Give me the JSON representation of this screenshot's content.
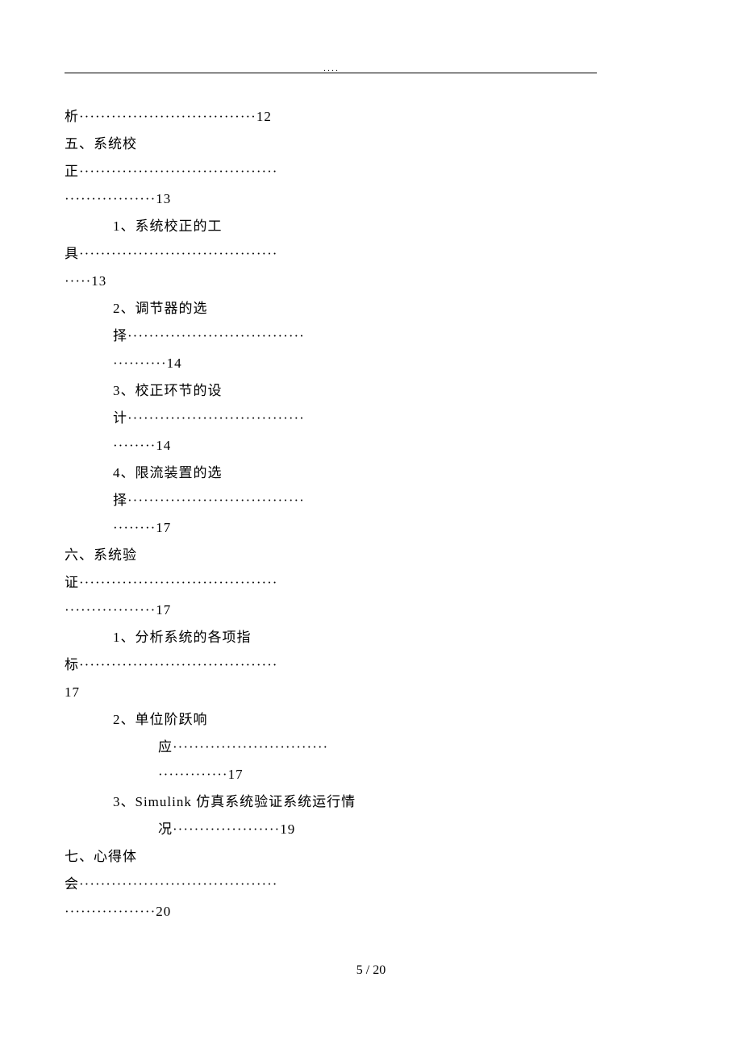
{
  "header_dots": ".                .                       .            .",
  "lines": [
    {
      "cls": "",
      "text": "析·································12"
    },
    {
      "cls": "",
      "text": "五、系统校"
    },
    {
      "cls": "",
      "text": "正·····································"
    },
    {
      "cls": "",
      "text": "·················13"
    },
    {
      "cls": "indent1",
      "text": "1、系统校正的工"
    },
    {
      "cls": "",
      "text": "具·····································"
    },
    {
      "cls": "",
      "text": "·····13"
    },
    {
      "cls": "indent1",
      "text": "2、调节器的选"
    },
    {
      "cls": "indent1",
      "text": "择·································"
    },
    {
      "cls": "indent1",
      "text": "··········14"
    },
    {
      "cls": "indent1",
      "text": "3、校正环节的设"
    },
    {
      "cls": "indent1",
      "text": "计·································"
    },
    {
      "cls": "indent1",
      "text": "········14"
    },
    {
      "cls": "indent1",
      "text": "4、限流装置的选"
    },
    {
      "cls": "indent1",
      "text": "择·································"
    },
    {
      "cls": "indent1",
      "text": "········17"
    },
    {
      "cls": "",
      "text": "六、系统验"
    },
    {
      "cls": "",
      "text": "证·····································"
    },
    {
      "cls": "",
      "text": "·················17"
    },
    {
      "cls": "indent1",
      "text": "1、分析系统的各项指"
    },
    {
      "cls": "",
      "text": "标·····································"
    },
    {
      "cls": "",
      "text": "17"
    },
    {
      "cls": "indent1",
      "text": "2、单位阶跃响"
    },
    {
      "cls": "indent2",
      "text": "应·····························"
    },
    {
      "cls": "indent2",
      "text": "·············17"
    },
    {
      "cls": "indent1",
      "text": "3、Simulink 仿真系统验证系统运行情"
    },
    {
      "cls": "indent2",
      "text": "况····················19"
    },
    {
      "cls": "",
      "text": "七、心得体"
    },
    {
      "cls": "",
      "text": "会·····································"
    },
    {
      "cls": "",
      "text": "·················20"
    }
  ],
  "footer": "5 / 20"
}
